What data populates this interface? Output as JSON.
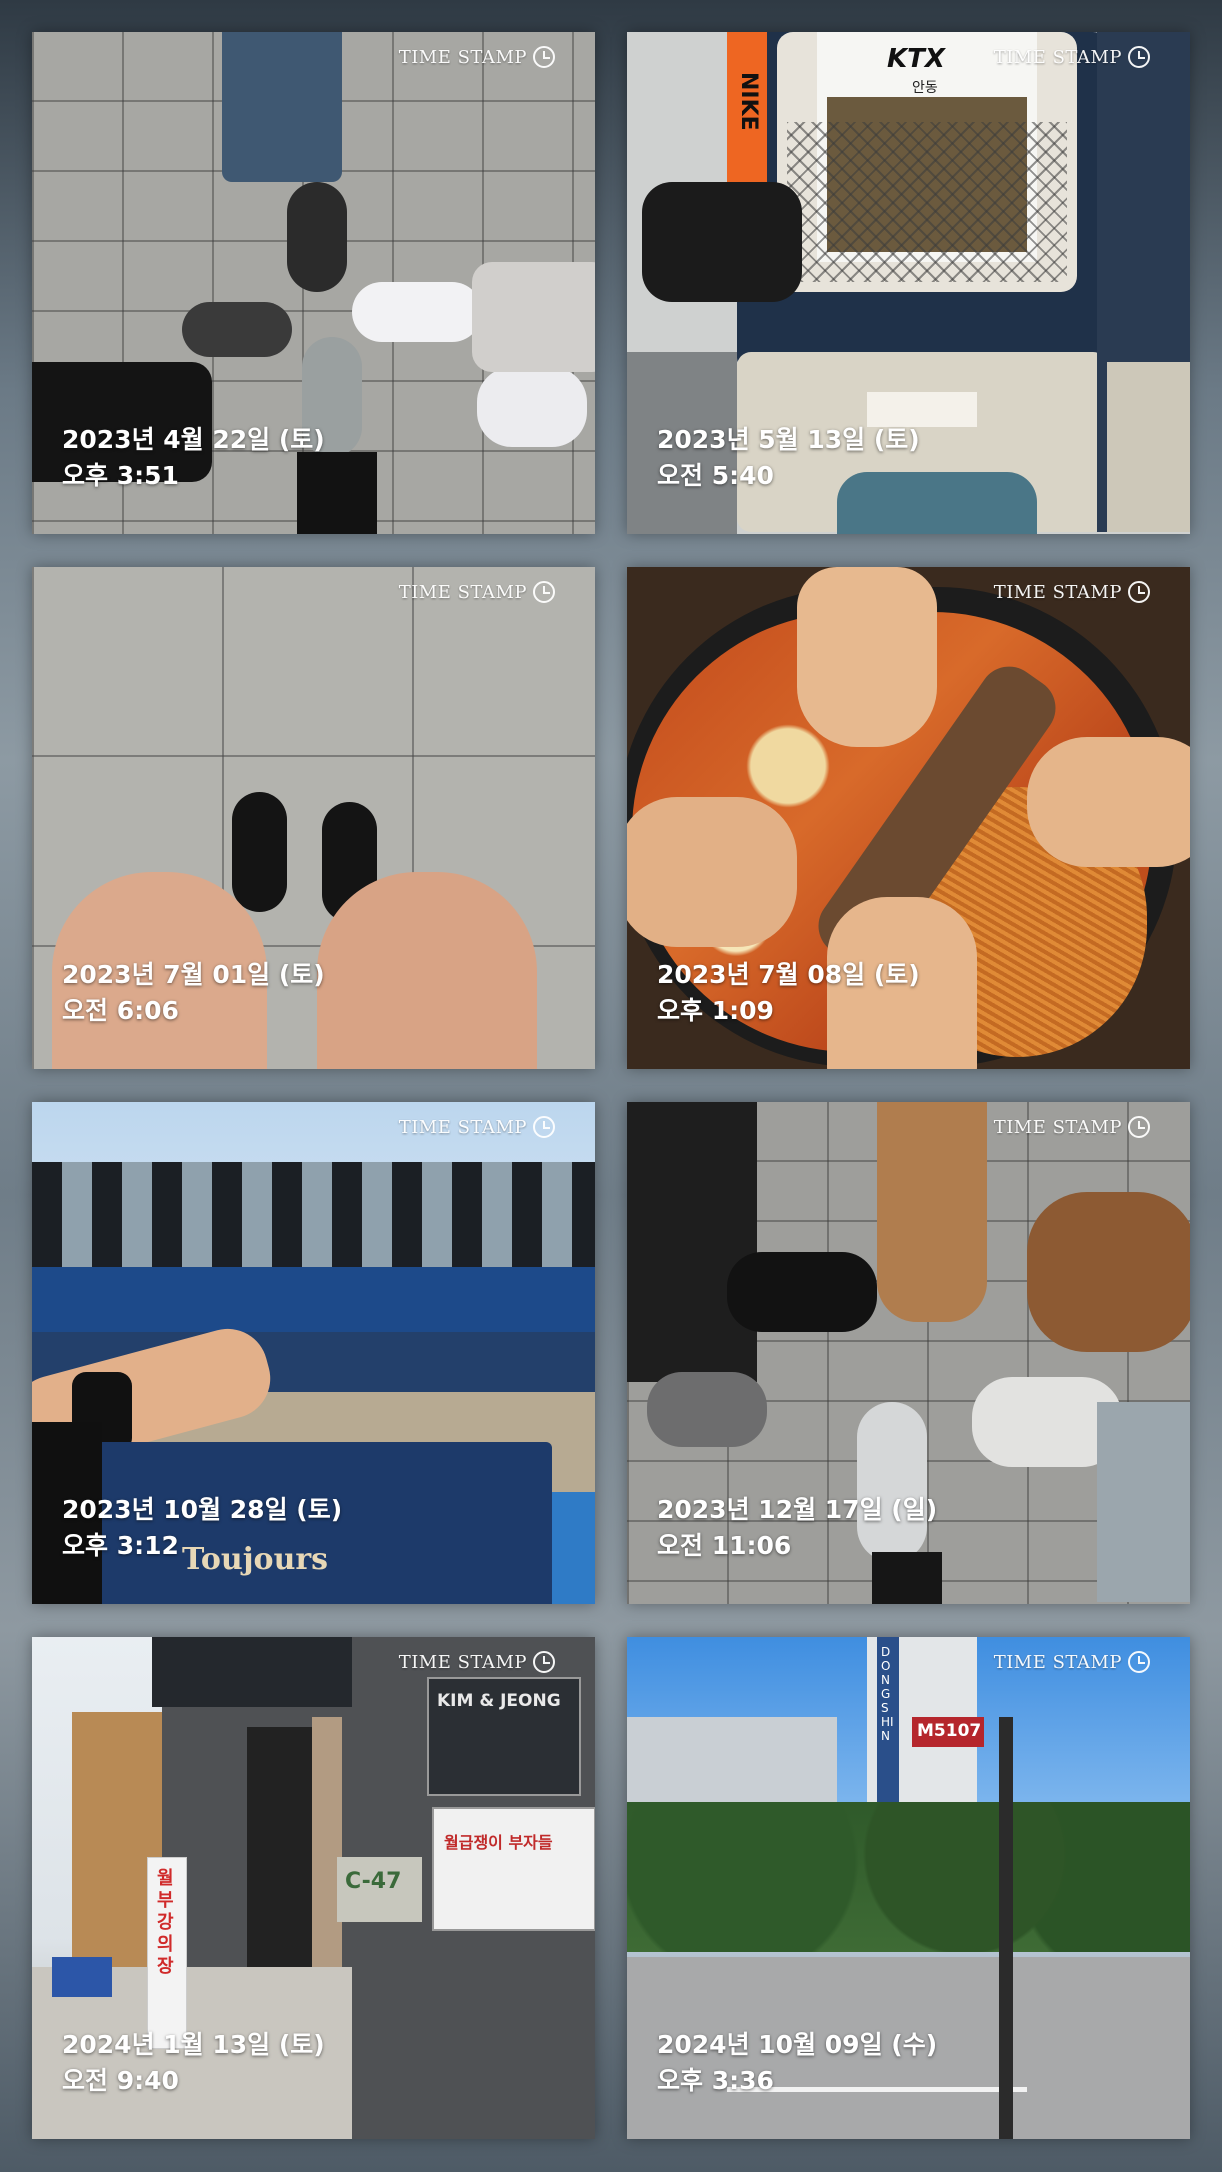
{
  "watermark": "TIME STAMP",
  "photos": [
    {
      "date": "2023년 4월 22일 (토)",
      "time": "오후 3:51",
      "subject": "feet-circle-pavement"
    },
    {
      "date": "2023년 5월 13일 (토)",
      "time": "오전 5:40",
      "subject": "ktx-train-seat"
    },
    {
      "date": "2023년 7월 01일 (토)",
      "time": "오전 6:06",
      "subject": "knees-tiles"
    },
    {
      "date": "2023년 7월 08일 (토)",
      "time": "오후 1:09",
      "subject": "hands-over-food"
    },
    {
      "date": "2023년 10월 28일 (토)",
      "time": "오후 3:12",
      "subject": "station-shopping-bag"
    },
    {
      "date": "2023년 12월 17일 (일)",
      "time": "오전 11:06",
      "subject": "feet-circle-bricks"
    },
    {
      "date": "2024년 1월 13일 (토)",
      "time": "오전 9:40",
      "subject": "office-building-street"
    },
    {
      "date": "2024년 10월 09일 (수)",
      "time": "오후 3:36",
      "subject": "bus-stop-street"
    }
  ],
  "signs": {
    "ktx": "KTX",
    "ktx_sub": "안동",
    "strap": "NIKE",
    "bag": "Toujours",
    "office_name": "KIM & JEONG",
    "office_studio": "C-47",
    "office_board": "월급쟁이 부자들",
    "banner": "월부강의장",
    "busstop_route": "M5107",
    "busstop_name": "DONG SHIN"
  }
}
